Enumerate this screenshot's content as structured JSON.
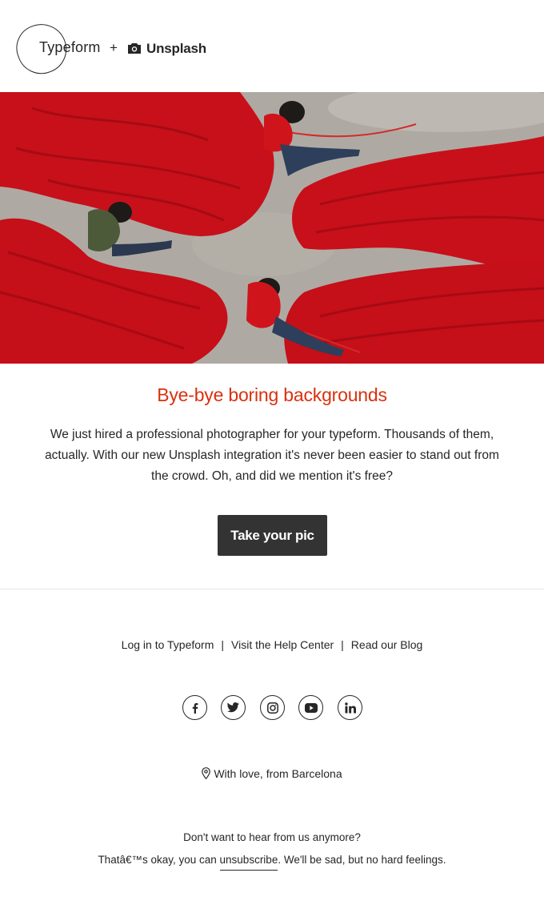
{
  "header": {
    "brand_left": "Typeform",
    "plus": "+",
    "brand_right": "Unsplash"
  },
  "hero": {
    "icon": "photo-red-fishing-nets"
  },
  "main": {
    "headline": "Bye-bye boring backgrounds",
    "body": "We just hired a professional photographer for your typeform. Thousands of them, actually. With our new Unsplash integration it's never been easier to stand out from the crowd. Oh, and did we mention it's free?",
    "cta_label": "Take your pic"
  },
  "footer": {
    "links": [
      "Log in to Typeform",
      "Visit the Help Center",
      "Read our Blog"
    ],
    "separator": "|",
    "socials": [
      "facebook-icon",
      "twitter-icon",
      "instagram-icon",
      "youtube-icon",
      "linkedin-icon"
    ],
    "location": "With love, from Barcelona",
    "unsubscribe_question": "Don't want to hear from us anymore?",
    "unsubscribe_prefix": "Thatâ€™s okay, you can ",
    "unsubscribe_link": "unsubscribe",
    "unsubscribe_suffix": ". We'll be sad, but no hard feelings."
  },
  "colors": {
    "accent": "#d9310f",
    "button_bg": "#333333",
    "text": "#262627",
    "net_red": "#c8101a"
  }
}
